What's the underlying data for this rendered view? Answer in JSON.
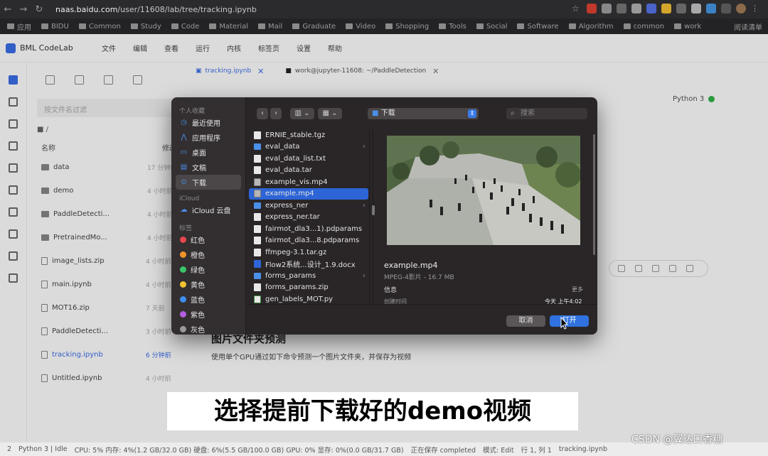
{
  "browser": {
    "url_prefix": "naas.baidu.com",
    "url_rest": "/user/11608/lab/tree/tracking.ipynb",
    "bookmarks": [
      "应用",
      "BIDU",
      "Common",
      "Study",
      "Code",
      "Material",
      "Mail",
      "Graduate",
      "Video",
      "Shopping",
      "Tools",
      "Social",
      "Software",
      "Algorithm",
      "common",
      "work"
    ],
    "bookmarks_right": "阅读清单"
  },
  "app": {
    "name": "BML CodeLab",
    "menu": [
      "文件",
      "编辑",
      "查看",
      "运行",
      "内核",
      "标签页",
      "设置",
      "帮助"
    ],
    "search_placeholder": "按文件名过滤",
    "path": "/",
    "col_name": "名称",
    "col_modified": "修改时间",
    "files": [
      {
        "name": "data",
        "time": "17 分钟前",
        "type": "folder"
      },
      {
        "name": "demo",
        "time": "4 小时前",
        "type": "folder"
      },
      {
        "name": "PaddleDetecti...",
        "time": "4 小时前",
        "type": "folder"
      },
      {
        "name": "PretrainedMo...",
        "time": "4 小时前",
        "type": "folder"
      },
      {
        "name": "image_lists.zip",
        "time": "4 小时前",
        "type": "file"
      },
      {
        "name": "main.ipynb",
        "time": "4 小时前",
        "type": "file"
      },
      {
        "name": "MOT16.zip",
        "time": "7 天前",
        "type": "file"
      },
      {
        "name": "PaddleDetecti...",
        "time": "3 小时前",
        "type": "file"
      },
      {
        "name": "tracking.ipynb",
        "time": "6 分钟前",
        "type": "file",
        "active": true
      },
      {
        "name": "Untitled.ipynb",
        "time": "4 小时前",
        "type": "file"
      }
    ],
    "tabs": [
      {
        "label": "tracking.ipynb",
        "active": true
      },
      {
        "label": "work@jupyter-11608: ~/PaddleDetection",
        "active": false
      }
    ],
    "kernel": "Python 3",
    "notebook_heading": "图片文件夹预测",
    "notebook_text": "使用单个GPU通过如下命令预测一个图片文件夹，并保存为视频"
  },
  "status": {
    "left": "2",
    "kernel_state": "Python 3 | Idle",
    "cpu": "CPU:  5% 内存:  4%(1.2 GB/32.0 GB) 硬盘:  6%(5.5 GB/100.0 GB)  GPU:  0%  显存:  0%(0.0 GB/31.7 GB)",
    "saving": "正在保存 completed",
    "mode": "模式:  Edit",
    "position": "行 1, 列 1",
    "filename": "tracking.ipynb"
  },
  "dialog": {
    "favorites_header": "个人收藏",
    "favorites": [
      {
        "label": "最近使用",
        "icon": "clock-icon"
      },
      {
        "label": "应用程序",
        "icon": "apps-icon"
      },
      {
        "label": "桌面",
        "icon": "desktop-icon"
      },
      {
        "label": "文稿",
        "icon": "document-icon"
      },
      {
        "label": "下载",
        "icon": "download-icon",
        "selected": true
      }
    ],
    "icloud_header": "iCloud",
    "icloud_item": "iCloud 云盘",
    "tags_header": "标签",
    "tags": [
      {
        "label": "红色",
        "color": "#e5484d"
      },
      {
        "label": "橙色",
        "color": "#f0932b"
      },
      {
        "label": "绿色",
        "color": "#3cc66a"
      },
      {
        "label": "黄色",
        "color": "#f2c230"
      },
      {
        "label": "蓝色",
        "color": "#3d8ef0"
      },
      {
        "label": "紫色",
        "color": "#b35ee0"
      },
      {
        "label": "灰色",
        "color": "#9a9a9a"
      }
    ],
    "location": "下载",
    "search_placeholder": "搜索",
    "files": [
      {
        "name": "ERNIE_stable.tgz",
        "kind": "file"
      },
      {
        "name": "eval_data",
        "kind": "folder"
      },
      {
        "name": "eval_data_list.txt",
        "kind": "file"
      },
      {
        "name": "eval_data.tar",
        "kind": "file"
      },
      {
        "name": "example_vis.mp4",
        "kind": "vid"
      },
      {
        "name": "example.mp4",
        "kind": "vid",
        "selected": true
      },
      {
        "name": "express_ner",
        "kind": "folder"
      },
      {
        "name": "express_ner.tar",
        "kind": "file"
      },
      {
        "name": "fairmot_dla3...1).pdparams",
        "kind": "file"
      },
      {
        "name": "fairmot_dla3...8.pdparams",
        "kind": "file"
      },
      {
        "name": "ffmpeg-3.1.tar.gz",
        "kind": "file"
      },
      {
        "name": "Flow2系统...设计_1.9.docx",
        "kind": "doc"
      },
      {
        "name": "forms_params",
        "kind": "folder"
      },
      {
        "name": "forms_params.zip",
        "kind": "file"
      },
      {
        "name": "gen_labels_MOT.py",
        "kind": "py"
      }
    ],
    "preview_name": "example.mp4",
    "preview_kind": "MPEG-4影片 - 16.7 MB",
    "info_label": "信息",
    "more_label": "更多",
    "created_label": "创建时间",
    "created_value": "今天 上午4:02",
    "cancel": "取消",
    "open": "打开"
  },
  "overlay": {
    "subtitle": "选择提前下载好的demo视频",
    "watermark": "CSDN @翼达口香糖"
  }
}
